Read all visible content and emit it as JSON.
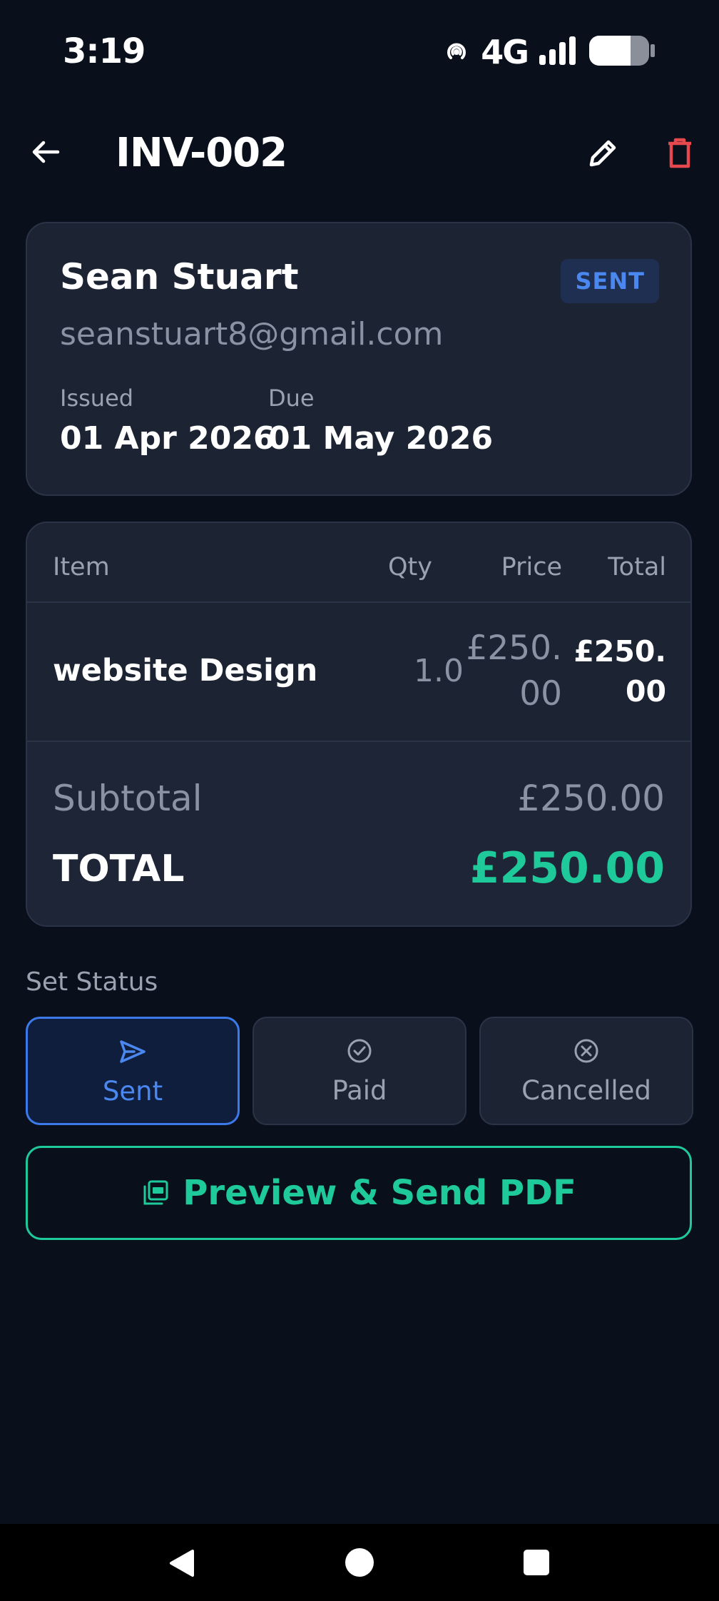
{
  "status_bar": {
    "time": "3:19",
    "network": "4G",
    "icons": [
      "hotspot-icon",
      "signal-icon",
      "battery-icon"
    ]
  },
  "app_bar": {
    "title": "INV-002",
    "icons": [
      "back-arrow-icon",
      "pencil-icon",
      "trash-icon"
    ],
    "delete_color": "#e5484d"
  },
  "client": {
    "name": "Sean Stuart",
    "email": "seanstuart8@gmail.com",
    "status_badge": "SENT",
    "issued_label": "Issued",
    "issued_date": "01 Apr 2026",
    "due_label": "Due",
    "due_date": "01 May 2026"
  },
  "items_table": {
    "columns": [
      "Item",
      "Qty",
      "Price",
      "Total"
    ],
    "rows": [
      {
        "item": "website Design",
        "qty": "1.0",
        "price": "£250.00",
        "total": "£250.00"
      }
    ],
    "subtotal_label": "Subtotal",
    "subtotal_value": "£250.00",
    "total_label": "TOTAL",
    "total_value": "£250.00"
  },
  "set_status": {
    "label": "Set Status",
    "options": [
      {
        "label": "Sent",
        "icon": "send-icon",
        "selected": true
      },
      {
        "label": "Paid",
        "icon": "check-circle-icon",
        "selected": false
      },
      {
        "label": "Cancelled",
        "icon": "x-circle-icon",
        "selected": false
      }
    ]
  },
  "pdf_button": {
    "label": "Preview & Send PDF",
    "icon": "pdf-icon"
  },
  "colors": {
    "background": "#0a0f1c",
    "card": "#1c2333",
    "accent_blue": "#4a88f0",
    "accent_green": "#1ec99a",
    "danger_red": "#e5484d"
  }
}
